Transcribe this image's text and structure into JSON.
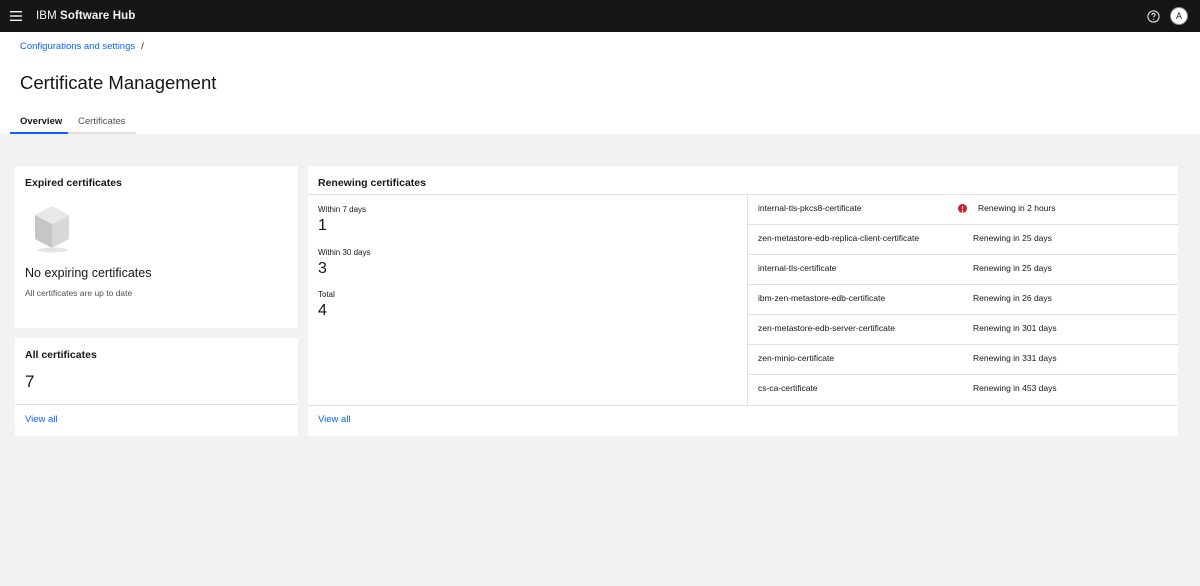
{
  "header": {
    "brand_ibm": "IBM",
    "brand_product": "Software Hub",
    "avatar_initial": "A"
  },
  "breadcrumb": {
    "items": [
      "Configurations and settings"
    ],
    "separator": "/"
  },
  "page": {
    "title": "Certificate Management",
    "tabs": [
      {
        "label": "Overview",
        "active": true
      },
      {
        "label": "Certificates",
        "active": false
      }
    ]
  },
  "expired": {
    "title": "Expired certificates",
    "empty_title": "No expiring certificates",
    "empty_subtitle": "All certificates are up to date"
  },
  "all_certificates": {
    "title": "All certificates",
    "count": "7",
    "link": "View all"
  },
  "renewing": {
    "title": "Renewing certificates",
    "stats": [
      {
        "label": "Within 7 days",
        "value": "1"
      },
      {
        "label": "Within 30 days",
        "value": "3"
      },
      {
        "label": "Total",
        "value": "4"
      }
    ],
    "link": "View all",
    "certificates": [
      {
        "name": "internal-tls-pkcs8-certificate",
        "status": "Renewing in 2 hours",
        "warning": true
      },
      {
        "name": "zen-metastore-edb-replica-client-certificate",
        "status": "Renewing in 25 days",
        "warning": false
      },
      {
        "name": "internal-tls-certificate",
        "status": "Renewing in 25 days",
        "warning": false
      },
      {
        "name": "ibm-zen-metastore-edb-certificate",
        "status": "Renewing in 26 days",
        "warning": false
      },
      {
        "name": "zen-metastore-edb-server-certificate",
        "status": "Renewing in 301 days",
        "warning": false
      },
      {
        "name": "zen-minio-certificate",
        "status": "Renewing in 331 days",
        "warning": false
      },
      {
        "name": "cs-ca-certificate",
        "status": "Renewing in 453 days",
        "warning": false
      }
    ]
  },
  "colors": {
    "header_bg": "#161616",
    "link": "#0f62fe",
    "warning": "#da1e28",
    "page_bg": "#f2f2f2"
  },
  "icons": {
    "menu": "hamburger-menu-icon",
    "help": "help-icon",
    "empty_state": "cube-icon",
    "warning": "error-filled-icon"
  }
}
